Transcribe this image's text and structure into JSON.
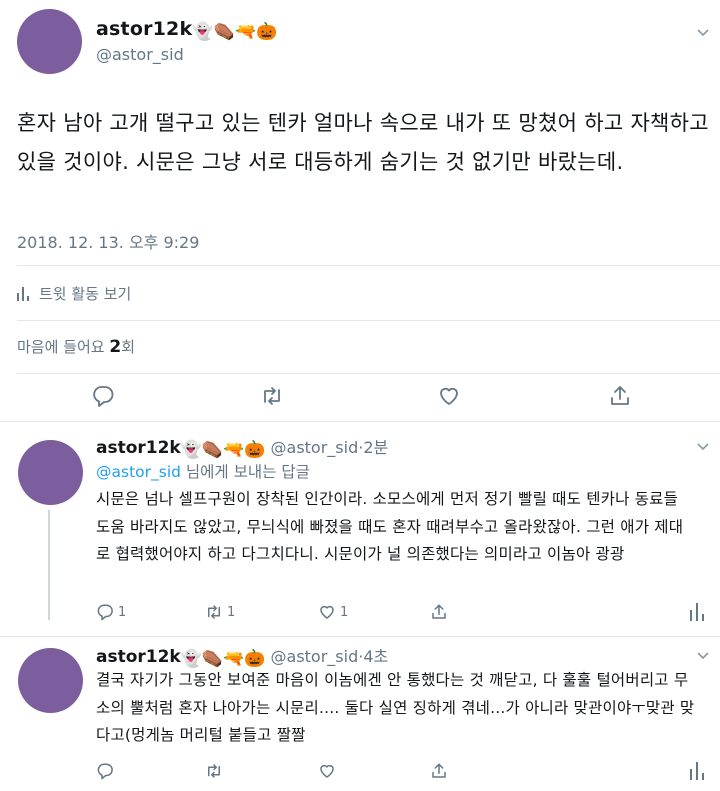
{
  "main_tweet": {
    "display_name": "astor12k",
    "emojis": "👻⚰️🔫🎃",
    "handle": "@astor_sid",
    "text": "혼자 남아 고개 떨구고 있는 텐카 얼마나 속으로 내가 또 망쳤어 하고 자책하고 있을 것이야. 시문은 그냥 서로 대등하게 숨기는 것 없기만 바랐는데.",
    "timestamp": "2018. 12. 13. 오후 9:29",
    "activity_label": "트윗 활동 보기",
    "likes_prefix": "마음에 들어요 ",
    "likes_count": "2",
    "likes_suffix": "회"
  },
  "replies": [
    {
      "display_name": "astor12k",
      "emojis": "👻⚰️🔫🎃",
      "handle": "@astor_sid",
      "dot": "·",
      "time": "2분",
      "replying_to": "@astor_sid",
      "replying_suffix": " 님에게 보내는 답글",
      "text": "시문은 넘나 셀프구원이 장착된 인간이라. 소모스에게 먼저 정기 빨릴 때도 텐카나 동료들 도움 바라지도 않았고, 무늬식에 빠졌을 때도 혼자 때려부수고 올라왔잖아. 그런 애가 제대로 협력했어야지 하고 다그치다니. 시문이가 널 의존했다는 의미라고 이놈아 광광",
      "reply_count": "1",
      "retweet_count": "1",
      "like_count": "1"
    },
    {
      "display_name": "astor12k",
      "emojis": "👻⚰️🔫🎃",
      "handle": "@astor_sid",
      "dot": "·",
      "time": "4초",
      "text": "결국 자기가 그동안 보여준 마음이 이놈에겐 안 통했다는 것 깨닫고, 다 훌훌 털어버리고 무소의 뿔처럼 혼자 나아가는 시문리.... 둘다 실연 징하게 겪네...가 아니라 맞관이야ㅜ맞관 맞다고(멍게놈 머리털 붙들고 짤짤"
    }
  ],
  "colors": {
    "avatar": "#7c5e9e",
    "text": "#14171a",
    "secondary": "#657786",
    "link": "#1da1f2",
    "divider": "#e1e8ed"
  }
}
